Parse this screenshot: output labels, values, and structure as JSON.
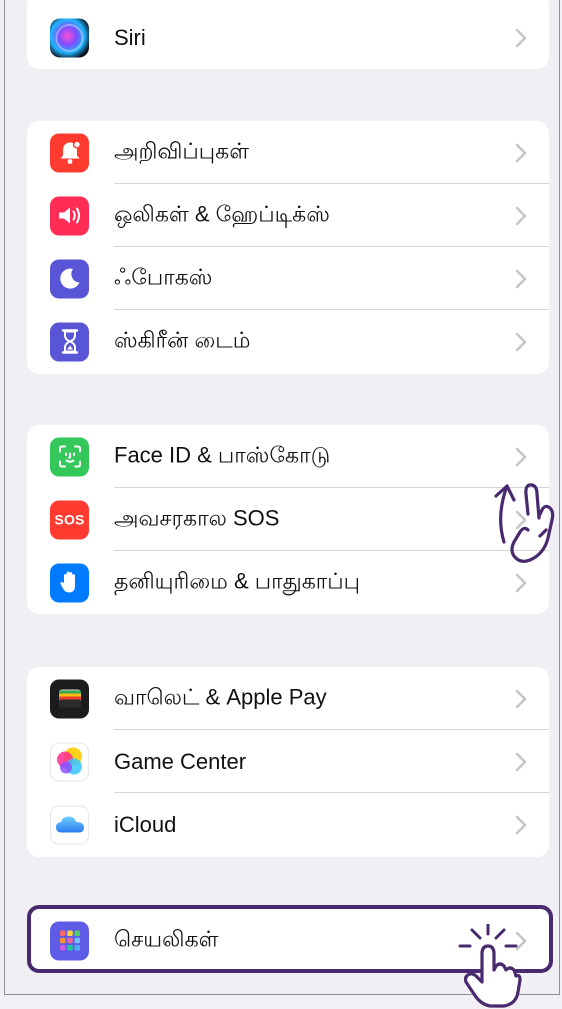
{
  "groups": [
    {
      "rows": [
        {
          "label": "Siri",
          "icon": "siri-icon"
        }
      ]
    },
    {
      "rows": [
        {
          "label": "அறிவிப்புகள்",
          "icon": "notifications-icon",
          "color": "#ff3b30"
        },
        {
          "label": "ஒலிகள் & ஹேப்டிக்ஸ்",
          "icon": "sounds-icon",
          "color": "#ff2d55"
        },
        {
          "label": "ஃபோகஸ்",
          "icon": "focus-moon-icon",
          "color": "#5856d6"
        },
        {
          "label": "ஸ்கிரீன் டைம்",
          "icon": "hourglass-icon",
          "color": "#5856d6"
        }
      ]
    },
    {
      "rows": [
        {
          "label": "Face ID & பாஸ்கோடு",
          "icon": "face-id-icon",
          "color": "#34c759"
        },
        {
          "label": "அவசரகால SOS",
          "icon": "sos-icon",
          "color": "#ff3b30",
          "icon_text": "SOS"
        },
        {
          "label": "தனியுரிமை & பாதுகாப்பு",
          "icon": "privacy-hand-icon",
          "color": "#007aff"
        }
      ]
    },
    {
      "rows": [
        {
          "label": "வாலெட் & Apple Pay",
          "icon": "wallet-icon",
          "color": "#1c1c1e"
        },
        {
          "label": "Game Center",
          "icon": "game-center-icon"
        },
        {
          "label": "iCloud",
          "icon": "icloud-icon"
        }
      ]
    },
    {
      "rows": [
        {
          "label": "செயலிகள்",
          "icon": "apps-grid-icon",
          "color": "#5e5ce6"
        }
      ]
    }
  ],
  "colors": {
    "highlight": "#4a2a6e",
    "chevron": "#c4c4c7"
  }
}
